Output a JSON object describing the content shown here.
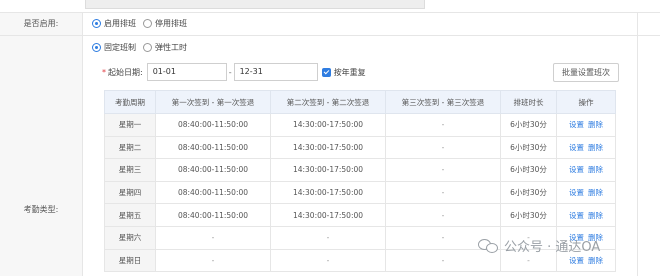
{
  "enable": {
    "label": "是否启用:",
    "options": [
      "启用排班",
      "停用排班"
    ],
    "selected_index": 0
  },
  "attendance_type": {
    "label": "考勤类型:",
    "options": [
      "固定班制",
      "弹性工时"
    ],
    "selected_index": 0
  },
  "date_range": {
    "required_mark": "*",
    "label": "起始日期:",
    "start": "01-01",
    "separator": "-",
    "end": "12-31",
    "repeat_label": "按年重复",
    "repeat_checked": true
  },
  "batch_button": "批量设置班次",
  "table": {
    "headers": [
      "考勤周期",
      "第一次签到 - 第一次签退",
      "第二次签到 - 第二次签退",
      "第三次签到 - 第三次签退",
      "排班时长",
      "操作"
    ],
    "rows": [
      {
        "day": "星期一",
        "s1": "08:40:00-11:50:00",
        "s2": "14:30:00-17:50:00",
        "s3": "-",
        "duration": "6小时30分",
        "ops": [
          "设置",
          "删除"
        ]
      },
      {
        "day": "星期二",
        "s1": "08:40:00-11:50:00",
        "s2": "14:30:00-17:50:00",
        "s3": "-",
        "duration": "6小时30分",
        "ops": [
          "设置",
          "删除"
        ]
      },
      {
        "day": "星期三",
        "s1": "08:40:00-11:50:00",
        "s2": "14:30:00-17:50:00",
        "s3": "-",
        "duration": "6小时30分",
        "ops": [
          "设置",
          "删除"
        ]
      },
      {
        "day": "星期四",
        "s1": "08:40:00-11:50:00",
        "s2": "14:30:00-17:50:00",
        "s3": "-",
        "duration": "6小时30分",
        "ops": [
          "设置",
          "删除"
        ]
      },
      {
        "day": "星期五",
        "s1": "08:40:00-11:50:00",
        "s2": "14:30:00-17:50:00",
        "s3": "-",
        "duration": "6小时30分",
        "ops": [
          "设置",
          "删除"
        ]
      },
      {
        "day": "星期六",
        "s1": "-",
        "s2": "-",
        "s3": "-",
        "duration": "-",
        "ops": [
          "设置",
          "删除"
        ]
      },
      {
        "day": "星期日",
        "s1": "-",
        "s2": "-",
        "s3": "-",
        "duration": "-",
        "ops": [
          "设置",
          "删除"
        ]
      }
    ]
  },
  "watermark": "公众号 · 通达OA",
  "colors": {
    "accent": "#2f7de1",
    "header_bg": "#eef3fb",
    "label_bg": "#f7f7f7"
  }
}
